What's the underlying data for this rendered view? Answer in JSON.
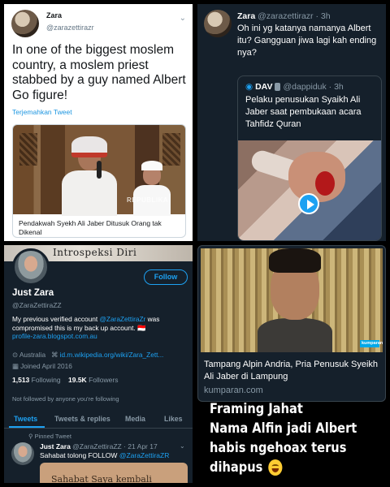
{
  "panel1": {
    "name": "Zara",
    "handle": "@zarazettirazr",
    "text": "In one of the biggest moslem country, a moslem priest stabbed by a guy named Albert Go figure!",
    "translate_label": "Terjemahkan Tweet",
    "card_caption": "Pendakwah Syekh Ali Jaber Ditusuk Orang tak Dikenal",
    "card_watermark": "REPUBLIKA"
  },
  "panel2": {
    "name": "Zara",
    "handle_time": "@zarazettirazr · 3h",
    "text": "Oh ini yg katanya namanya Albert itu? Gangguan jiwa lagi kah ending nya?",
    "quote_name": "DAV",
    "quote_handle": "@dappiduk · 3h",
    "quote_text": "Pelaku penusukan Syaikh Ali Jaber saat pembukaan acara Tahfidz Quran"
  },
  "panel3": {
    "banner_text": "Introspeksi Diri",
    "follow_label": "Follow",
    "name": "Just Zara",
    "handle": "@ZaraZettiraZZ",
    "bio_prefix": "My previous verified account ",
    "bio_mention": "@ZaraZettiraZr",
    "bio_suffix": " was compromised this is my back up account. 🇮🇩",
    "bio_link": "profile-zara.blogspot.com.au",
    "location": "Australia",
    "website": "id.m.wikipedia.org/wiki/Zara_Zett...",
    "joined": "Joined April 2016",
    "following_count": "1,513",
    "following_label": "Following",
    "followers_count": "19.5K",
    "followers_label": "Followers",
    "not_followed": "Not followed by anyone you're following",
    "tabs": [
      "Tweets",
      "Tweets & replies",
      "Media",
      "Likes"
    ],
    "pinned_label": "Pinned Tweet",
    "tweet_name": "Just Zara",
    "tweet_handle_time": "@ZaraZettiraZZ · 21 Apr 17",
    "tweet_text_prefix": "Sahabat tolong FOLLOW ",
    "tweet_text_mention": "@ZaraZettiraZR",
    "tweet_card_text": "Sahabat Saya kembali"
  },
  "panel4": {
    "watermark": "kumparan",
    "title_line1": "Tampang Alpin Andria, Pria Penusuk Syeikh",
    "title_line2": "Ali Jaber di Lampung",
    "domain": "kumparan.com"
  },
  "overlay": {
    "line1": "Framing Jahat",
    "line2": "Nama Alfin jadi Albert",
    "line3": "habis ngehoax terus",
    "line4": "dihapus",
    "emoji": "laughing-with-tears-emoji"
  },
  "colors": {
    "twitter_blue": "#1da1f2",
    "dark_bg": "#15202b",
    "muted": "#8899a6"
  }
}
